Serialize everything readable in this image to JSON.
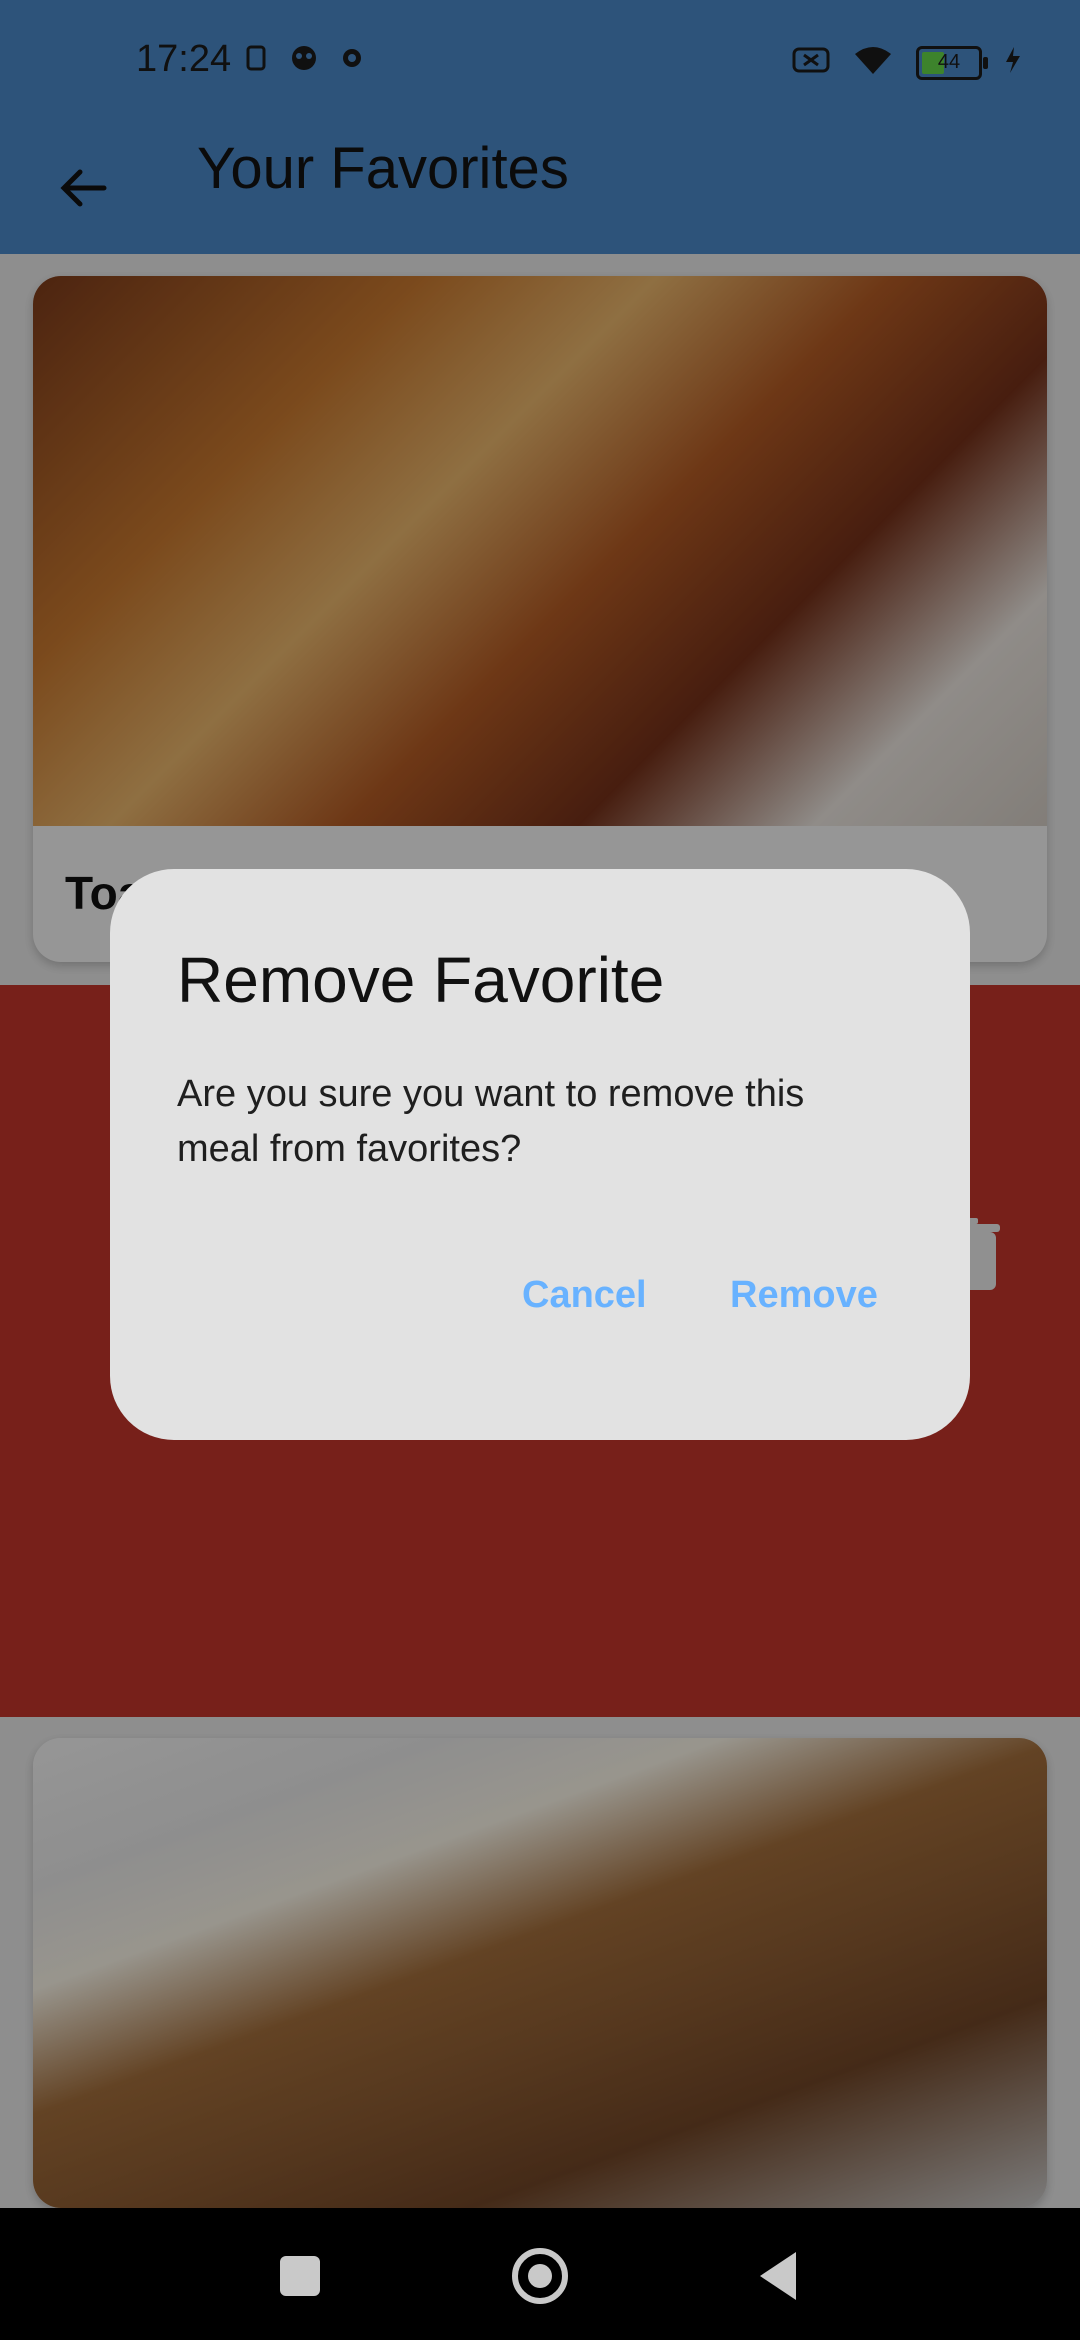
{
  "status": {
    "time": "17:24",
    "battery_level": "44",
    "icons_left": [
      "sim-icon",
      "face-icon",
      "settings-icon"
    ],
    "icons_right": [
      "no-signal-icon",
      "wifi-icon",
      "battery-icon",
      "charging-icon"
    ]
  },
  "appbar": {
    "title": "Your Favorites",
    "back_icon": "back-arrow-icon",
    "color": "#4a86c5"
  },
  "favorites": [
    {
      "title": "Toa"
    },
    {
      "title": ""
    }
  ],
  "swipe": {
    "action_icon": "trash-icon",
    "color": "#c0342a"
  },
  "dialog": {
    "title": "Remove Favorite",
    "message": "Are you sure you want to remove this meal from favorites?",
    "cancel_label": "Cancel",
    "remove_label": "Remove",
    "accent": "#68b2ff"
  },
  "navbar": {
    "icons": [
      "recent-apps-icon",
      "home-icon",
      "back-icon"
    ]
  }
}
